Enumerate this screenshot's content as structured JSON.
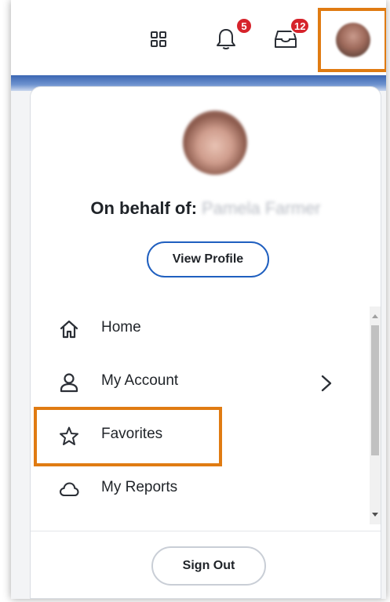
{
  "header": {
    "notifications_count": "5",
    "inbox_count": "12",
    "icons": {
      "apps": "apps-grid-icon",
      "notifications": "bell-icon",
      "inbox": "inbox-icon"
    }
  },
  "profile": {
    "behalf_label": "On behalf of:",
    "behalf_name": "Pamela Farmer",
    "view_profile_label": "View Profile"
  },
  "menu": {
    "items": [
      {
        "label": "Home",
        "icon": "home-icon"
      },
      {
        "label": "My Account",
        "icon": "person-icon",
        "has_submenu": true
      },
      {
        "label": "Favorites",
        "icon": "star-icon"
      },
      {
        "label": "My Reports",
        "icon": "cloud-icon"
      }
    ]
  },
  "footer": {
    "sign_out_label": "Sign Out"
  },
  "colors": {
    "highlight": "#e07b12",
    "badge": "#d6232b",
    "primary_button_border": "#1f5fbf"
  }
}
